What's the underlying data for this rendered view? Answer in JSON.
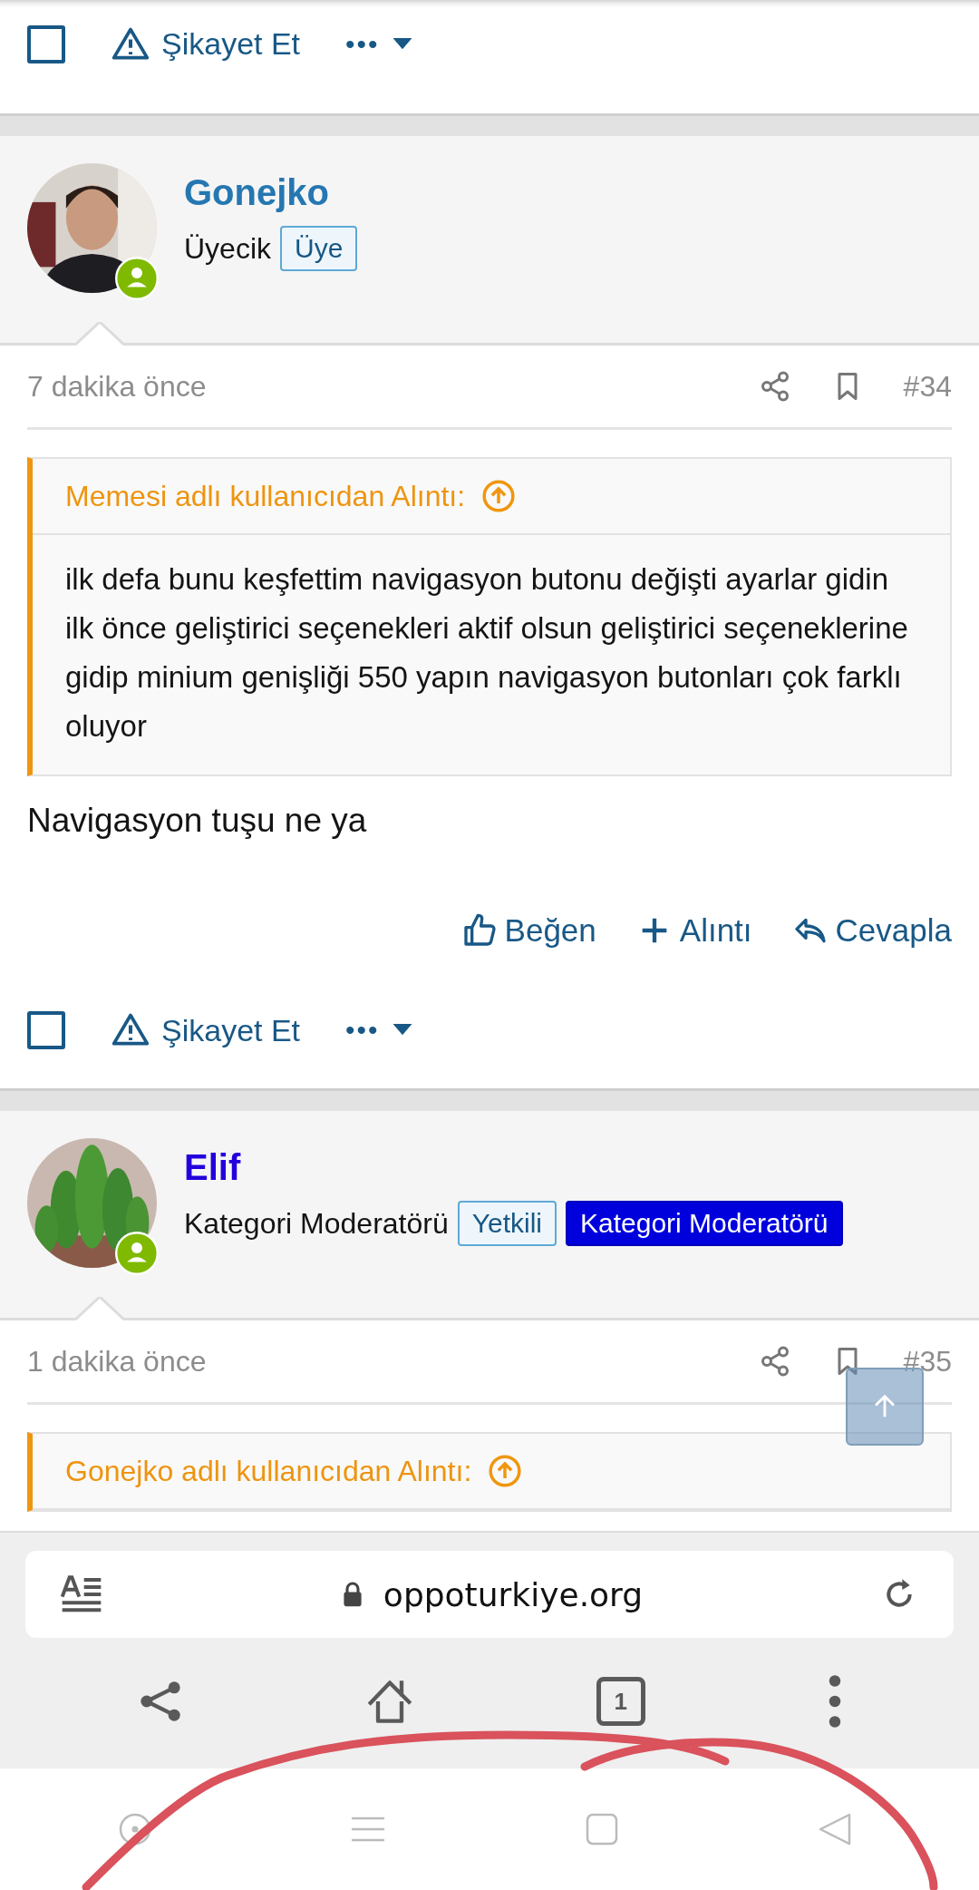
{
  "previous_post_footer": {
    "checked": false,
    "report": "Şikayet Et",
    "more": "•••"
  },
  "posts": [
    {
      "author": "Gonejko",
      "color": "#2577b1",
      "online": true,
      "title": "Üyecik",
      "badges": [
        {
          "label": "Üye",
          "kind": "outline"
        }
      ],
      "time": "7 dakika önce",
      "number": "#34",
      "quote": {
        "title": "Memesi adlı kullanıcıdan Alıntı:",
        "text": "ilk defa bunu keşfettim navigasyon butonu değişti ayarlar gidin ilk önce geliştirici seçenekleri aktif olsun geliştirici seçeneklerine gidip minium genişliği 550 yapın navigasyon butonları çok farklı oluyor"
      },
      "body": "Navigasyon tuşu ne ya",
      "actions": [
        {
          "kind": "like",
          "label": "Beğen"
        },
        {
          "kind": "quote",
          "label": "Alıntı"
        },
        {
          "kind": "reply",
          "label": "Cevapla"
        }
      ],
      "footer": {
        "checked": false,
        "report": "Şikayet Et",
        "more": "•••"
      }
    },
    {
      "author": "Elif",
      "color": "#2200dd",
      "online": true,
      "title": "Kategori Moderatörü",
      "badges": [
        {
          "label": "Yetkili",
          "kind": "outline"
        },
        {
          "label": "Kategori Moderatörü",
          "kind": "solid"
        }
      ],
      "time": "1 dakika önce",
      "number": "#35",
      "quote": {
        "title": "Gonejko adlı kullanıcıdan Alıntı:"
      }
    }
  ],
  "browser": {
    "url": "oppoturkiye.org",
    "tab_count": "1"
  }
}
